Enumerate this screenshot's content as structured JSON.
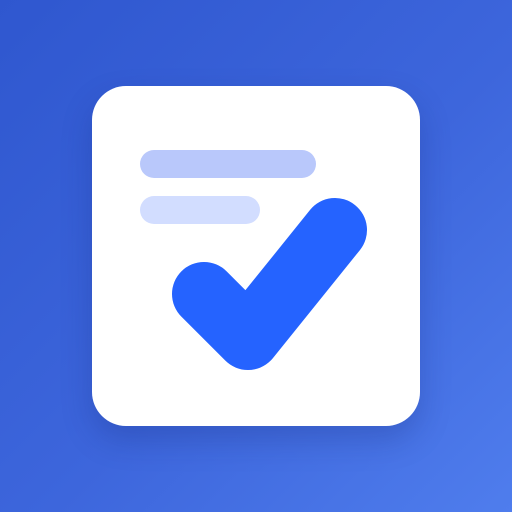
{
  "icon": {
    "name": "task-checklist-app-icon",
    "colors": {
      "background_start": "#2f57cf",
      "background_end": "#4f7ded",
      "card": "#ffffff",
      "line_primary": "#b9c8fb",
      "line_secondary": "#d2ddff",
      "check": "#2563ff"
    },
    "elements": [
      "text-line-icon",
      "text-line-icon",
      "check-icon"
    ]
  }
}
